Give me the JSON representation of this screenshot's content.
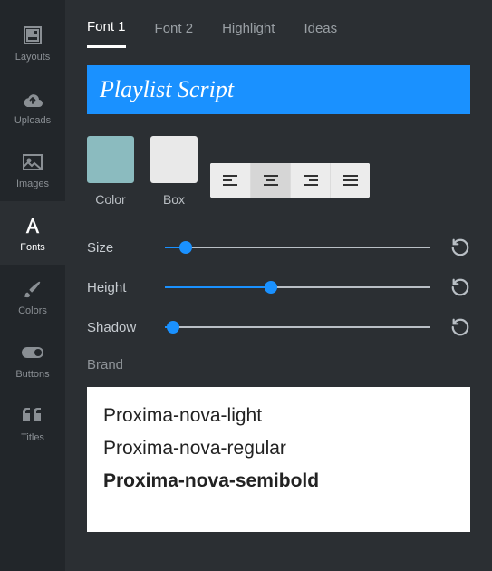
{
  "sidebar": {
    "items": [
      {
        "label": "Layouts"
      },
      {
        "label": "Uploads"
      },
      {
        "label": "Images"
      },
      {
        "label": "Fonts"
      },
      {
        "label": "Colors"
      },
      {
        "label": "Buttons"
      },
      {
        "label": "Titles"
      }
    ],
    "active_index": 3
  },
  "tabs": {
    "items": [
      {
        "label": "Font 1"
      },
      {
        "label": "Font 2"
      },
      {
        "label": "Highlight"
      },
      {
        "label": "Ideas"
      }
    ],
    "active_index": 0
  },
  "font_preview": {
    "name": "Playlist Script",
    "bg": "#1a91ff"
  },
  "swatches": {
    "color_label": "Color",
    "box_label": "Box",
    "color_value": "#8bbbbf",
    "box_value": "#e9e9e9"
  },
  "alignment": {
    "options": [
      "left",
      "center",
      "right",
      "justify"
    ],
    "active_index": 1
  },
  "sliders": {
    "size": {
      "label": "Size",
      "value": 8,
      "min": 0,
      "max": 100
    },
    "height": {
      "label": "Height",
      "value": 40,
      "min": 0,
      "max": 100
    },
    "shadow": {
      "label": "Shadow",
      "value": 3,
      "min": 0,
      "max": 100
    }
  },
  "brand": {
    "label": "Brand",
    "fonts": [
      {
        "name": "Proxima-nova-light",
        "weight": "light"
      },
      {
        "name": "Proxima-nova-regular",
        "weight": "regular"
      },
      {
        "name": "Proxima-nova-semibold",
        "weight": "semibold"
      }
    ]
  }
}
